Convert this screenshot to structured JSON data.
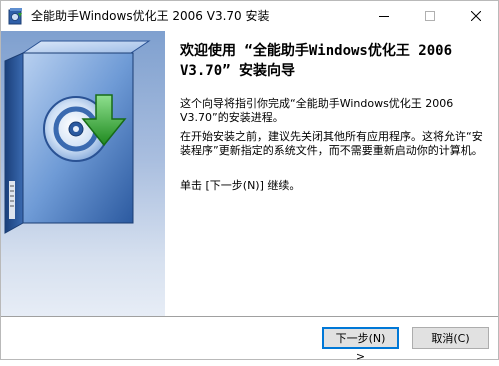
{
  "window": {
    "title": "全能助手Windows优化王 2006 V3.70 安装"
  },
  "content": {
    "heading": "欢迎使用 “全能助手Windows优化王 2006 V3.70” 安装向导",
    "paragraph1": "这个向导将指引你完成“全能助手Windows优化王 2006 V3.70”的安装进程。",
    "paragraph2": "在开始安装之前，建议先关闭其他所有应用程序。这将允许“安装程序”更新指定的系统文件，而不需要重新启动你的计算机。",
    "paragraph3": "单击 [下一步(N)] 继续。"
  },
  "buttons": {
    "next": "下一步(N) >",
    "cancel": "取消(C)"
  },
  "icons": {
    "app": "installer-icon",
    "minimize": "minimize-icon",
    "maximize": "maximize-icon",
    "close": "close-icon",
    "banner": "disc-download-box-icon"
  },
  "colors": {
    "accent": "#0078d7",
    "banner_top": "#7fa0cf",
    "arrow_green": "#2e9a2e"
  }
}
